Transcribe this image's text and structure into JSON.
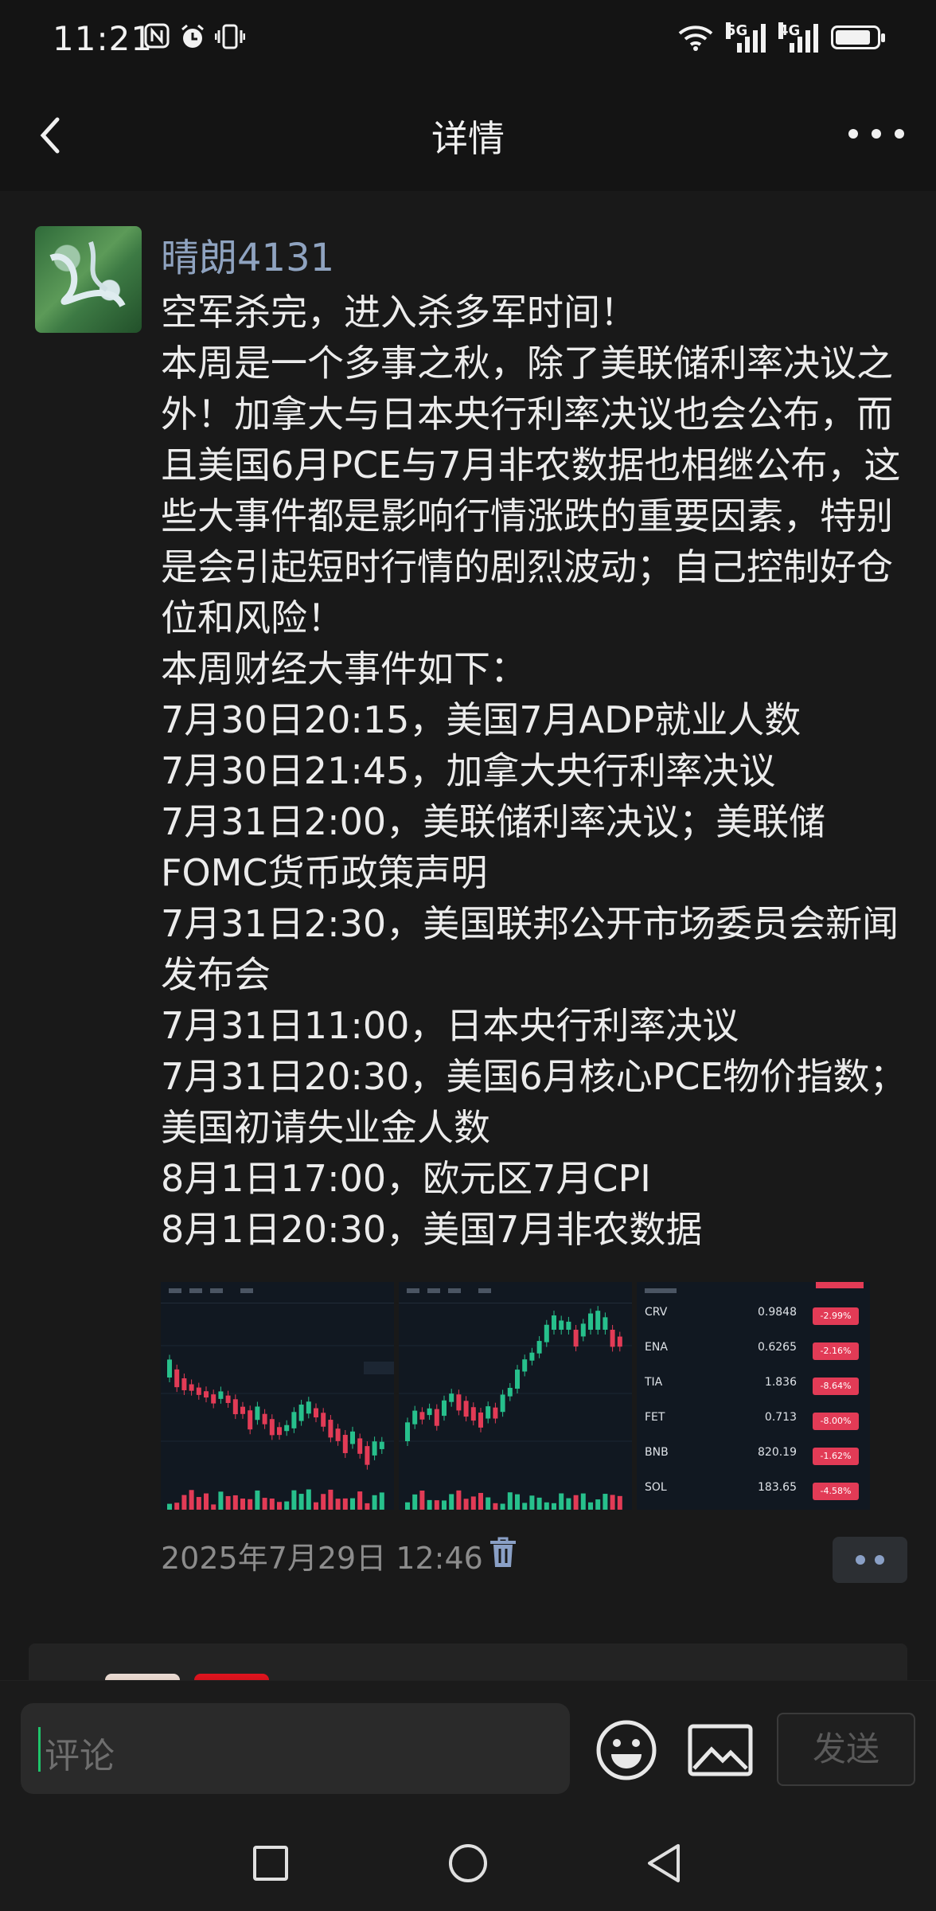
{
  "status_bar": {
    "time": "11:21",
    "network_1": "5G",
    "network_2": "4G",
    "battery_level": 0.85
  },
  "nav": {
    "title": "详情"
  },
  "post": {
    "username": "晴朗4131",
    "text": "空军杀完，进入杀多军时间！\n本周是一个多事之秋，除了美联储利率决议之外！加拿大与日本央行利率决议也会公布，而且美国6月PCE与7月非农数据也相继公布，这些大事件都是影响行情涨跌的重要因素，特别是会引起短时行情的剧烈波动；自己控制好仓位和风险！\n本周财经大事件如下：\n7月30日20:15，美国7月ADP就业人数\n7月30日21:45，加拿大央行利率决议\n7月31日2:00，美联储利率决议；美联储FOMC货币政策声明\n7月31日2:30，美国联邦公开市场委员会新闻发布会\n7月31日11:00，日本央行利率决议\n7月31日20:30，美国6月核心PCE物价指数；美国初请失业金人数\n8月1日17:00，欧元区7月CPI\n8月1日20:30，美国7月非农数据",
    "timestamp": "2025年7月29日 12:46",
    "tickers": [
      {
        "name": "CRV",
        "price": "0.9848",
        "change": "-2.99%"
      },
      {
        "name": "ENA",
        "price": "0.6265",
        "change": "-2.16%"
      },
      {
        "name": "TIA",
        "price": "1.836",
        "change": "-8.64%"
      },
      {
        "name": "FET",
        "price": "0.713",
        "change": "-8.00%"
      },
      {
        "name": "BNB",
        "price": "820.19",
        "change": "-1.62%"
      },
      {
        "name": "SOL",
        "price": "183.65",
        "change": "-4.58%"
      }
    ]
  },
  "comment_bar": {
    "placeholder": "评论",
    "send_label": "发送"
  },
  "colors": {
    "background": "#191919",
    "username": "#8fa3c0",
    "cursor": "#1ec46a",
    "candle_up": "#27c08c",
    "candle_down": "#e23b56"
  },
  "icons": [
    "back-icon",
    "more-icon",
    "trash-icon",
    "emoji-icon",
    "image-icon",
    "square-icon",
    "circle-icon",
    "triangle-back-icon"
  ]
}
